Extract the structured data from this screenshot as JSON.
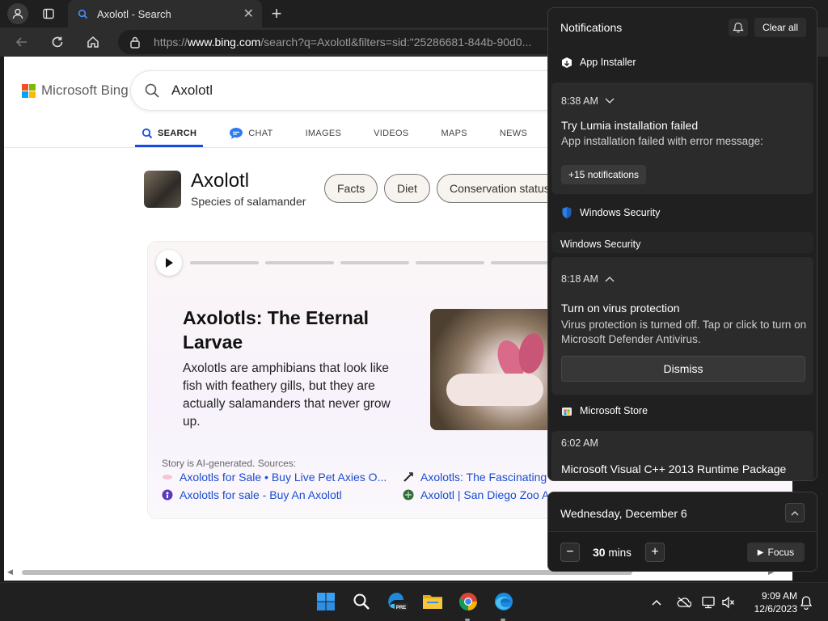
{
  "browser": {
    "tab_title": "Axolotl - Search",
    "url_prefix": "https://",
    "url_domain": "www.bing.com",
    "url_rest": "/search?q=Axolotl&filters=sid:\"25286681-844b-90d0..."
  },
  "bing": {
    "logo_text": "Microsoft Bing",
    "query": "Axolotl",
    "scopes": [
      "SEARCH",
      "CHAT",
      "IMAGES",
      "VIDEOS",
      "MAPS",
      "NEWS"
    ],
    "entity_name": "Axolotl",
    "entity_subtitle": "Species of salamander",
    "chips": [
      "Facts",
      "Diet",
      "Conservation status"
    ],
    "story_title": "Axolotls: The Eternal Larvae",
    "story_body": "Axolotls are amphibians that look like fish with feathery gills, but they are actually salamanders that never grow up.",
    "sources_label": "Story is AI-generated. Sources:",
    "sources": [
      "Axolotls for Sale • Buy Live Pet Axies O...",
      "Axolotls: The Fascinating",
      "Axolotls for sale - Buy An Axolotl",
      "Axolotl | San Diego Zoo A"
    ],
    "colors": {
      "accent": "#174ae4",
      "link": "#1a4ccf"
    }
  },
  "notifications": {
    "title": "Notifications",
    "clear_all": "Clear all",
    "groups": [
      {
        "app": "App Installer",
        "time": "8:38 AM",
        "heading": "Try Lumia installation failed",
        "body": "App installation failed with error message:",
        "more": "+15 notifications"
      },
      {
        "app": "Windows Security",
        "sub_label": "Windows Security",
        "time": "8:18 AM",
        "heading": "Turn on virus protection",
        "body": "Virus protection is turned off. Tap or click to turn on Microsoft Defender Antivirus.",
        "action": "Dismiss"
      },
      {
        "app": "Microsoft Store",
        "time": "6:02 AM",
        "heading": "Microsoft Visual C++ 2013 Runtime Package"
      }
    ]
  },
  "calendar": {
    "date": "Wednesday, December 6",
    "focus_value": "30",
    "focus_unit": "mins",
    "minus": "−",
    "plus": "+",
    "focus_label": "Focus"
  },
  "taskbar": {
    "time": "9:09 AM",
    "date": "12/6/2023",
    "pre_badge": "PRE"
  }
}
